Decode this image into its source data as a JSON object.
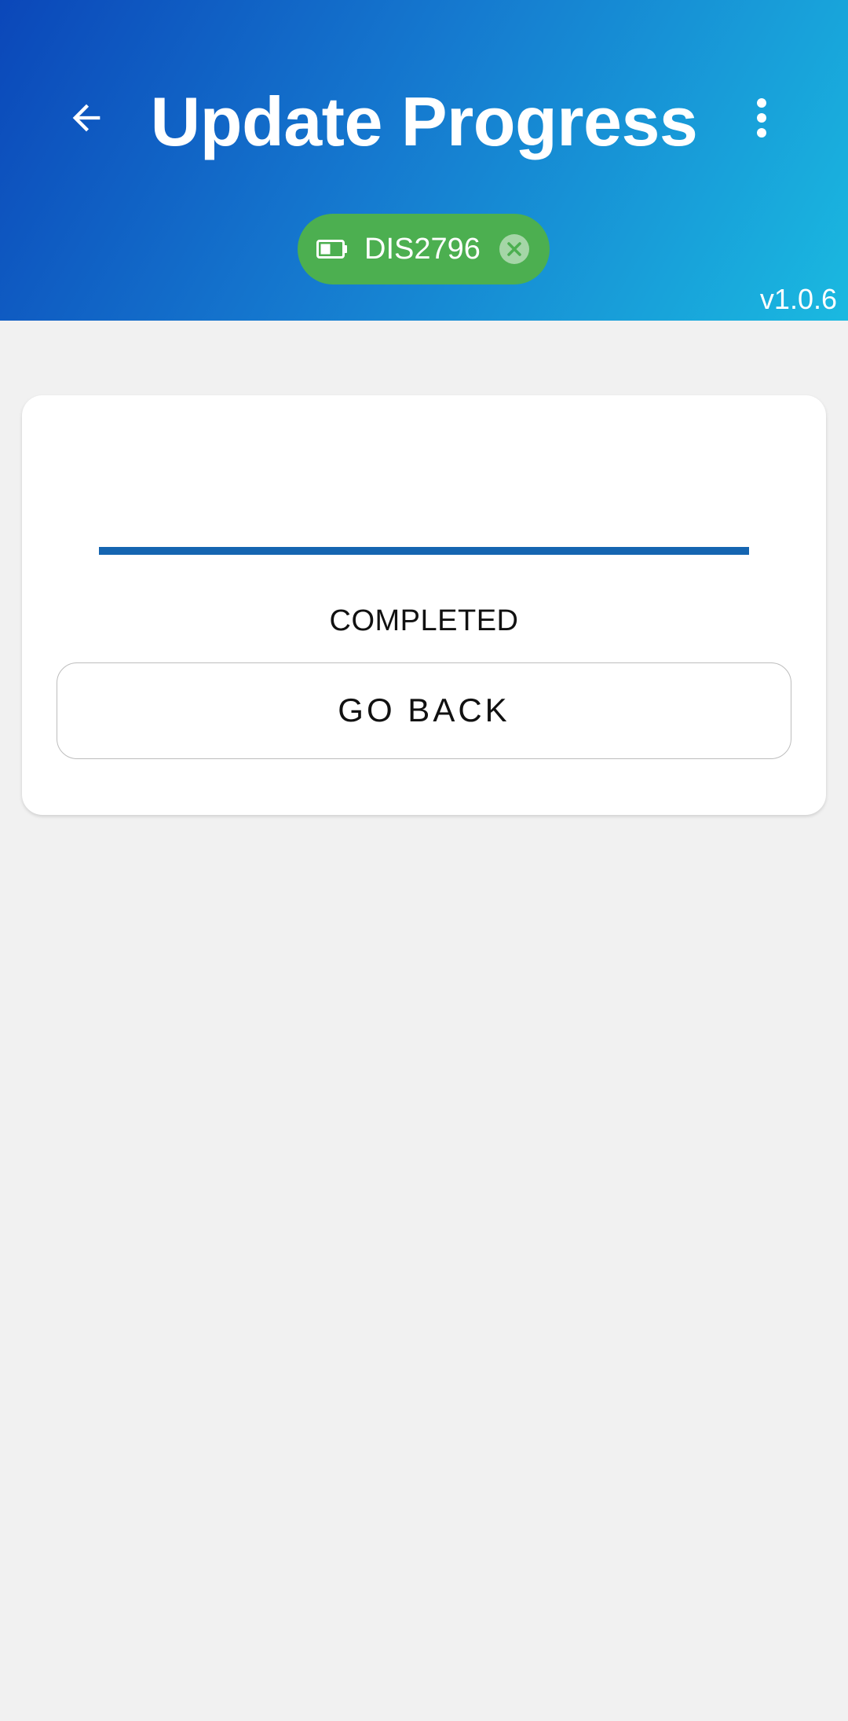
{
  "header": {
    "title": "Update Progress",
    "back_icon": "arrow-left-icon",
    "menu_icon": "more-vertical-icon",
    "version": "v1.0.6",
    "gradient": [
      "#0b47b9",
      "#1ab9e0"
    ]
  },
  "device_chip": {
    "label": "DIS2796",
    "icon": "battery-icon",
    "close_icon": "close-circle-icon",
    "color": "#4caf50"
  },
  "progress": {
    "value_percent": 100,
    "status": "COMPLETED",
    "color": "#1565b1"
  },
  "actions": {
    "go_back_label": "GO BACK"
  }
}
